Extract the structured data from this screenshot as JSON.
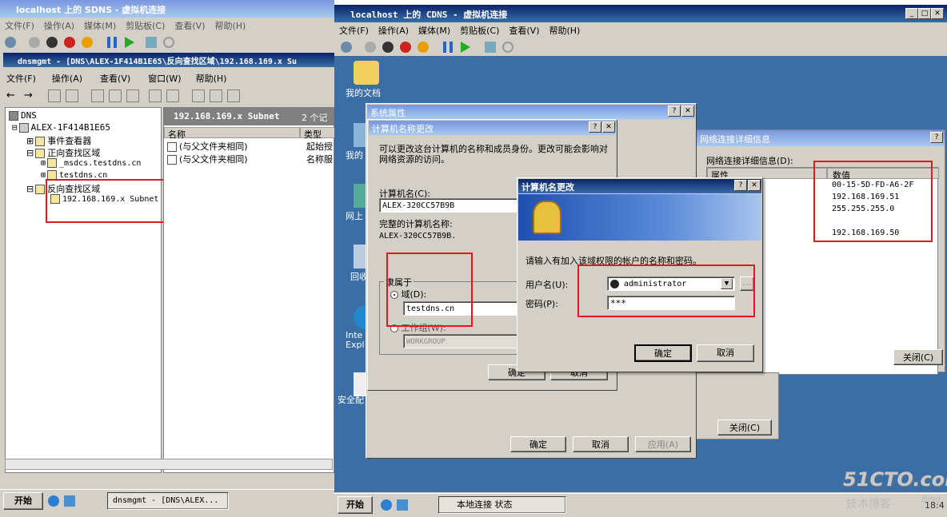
{
  "left_window": {
    "title": "localhost 上的 SDNS - 虚拟机连接",
    "menu": [
      "文件(F)",
      "操作(A)",
      "媒体(M)",
      "剪贴板(C)",
      "查看(V)",
      "帮助(H)"
    ]
  },
  "mmc": {
    "title": "dnsmgmt - [DNS\\ALEX-1F414B1E65\\反向查找区域\\192.168.169.x Su",
    "menu": [
      "文件(F)",
      "操作(A)",
      "查看(V)",
      "窗口(W)",
      "帮助(H)"
    ],
    "tree": [
      "DNS",
      "ALEX-1F414B1E65",
      "事件查看器",
      "正向查找区域",
      "_msdcs.testdns.cn",
      "testdns.cn",
      "反向查找区域",
      "192.168.169.x Subnet"
    ],
    "list_header": "192.168.169.x Subnet",
    "list_count": "2 个记",
    "columns": [
      "名称",
      "类型"
    ],
    "rows": [
      {
        "name": "(与父文件夹相同)",
        "type": "起始授"
      },
      {
        "name": "(与父文件夹相同)",
        "type": "名称服"
      }
    ]
  },
  "left_taskbar": {
    "start": "开始",
    "task": "dnsmgmt - [DNS\\ALEX..."
  },
  "right_window": {
    "title": "localhost 上的 CDNS - 虚拟机连接",
    "menu": [
      "文件(F)",
      "操作(A)",
      "媒体(M)",
      "剪贴板(C)",
      "查看(V)",
      "帮助(H)"
    ]
  },
  "desktop_icons": [
    "我的文档",
    "我的",
    "网上",
    "回收",
    "Inte\nExpl",
    "安全配"
  ],
  "sysprops": {
    "title": "系统属性",
    "buttons": [
      "确定",
      "取消",
      "应用(A)"
    ]
  },
  "namechange": {
    "title": "计算机名称更改",
    "desc": "可以更改这台计算机的名称和成员身份。更改可能会影响对网络资源的访问。",
    "name_label": "计算机名(C):",
    "name_value": "ALEX-320CC57B9B",
    "full_label": "完整的计算机名称:",
    "full_value": "ALEX-320CC57B9B.",
    "member_label": "隶属于",
    "domain_label": "域(D):",
    "domain_value": "testdns.cn",
    "workgroup_label": "工作组(W):",
    "workgroup_value": "WORKGROUP",
    "ok": "确定",
    "cancel": "取消"
  },
  "credentials": {
    "title": "计算机名更改",
    "prompt": "请输入有加入该域权限的帐户的名称和密码。",
    "user_label": "用户名(U):",
    "user_value": "administrator",
    "pwd_label": "密码(P):",
    "pwd_value": "***",
    "ok": "确定",
    "cancel": "取消"
  },
  "netdetail": {
    "title": "网络连接详细信息",
    "subtitle": "网络连接详细信息(D):",
    "columns": [
      "属性",
      "数值"
    ],
    "values": [
      "00-15-5D-FD-A6-2F",
      "192.168.169.51",
      "255.255.255.0",
      "",
      "192.168.169.50"
    ],
    "close": "关闭(C)"
  },
  "netstatus": {
    "close": "关闭(C)"
  },
  "right_taskbar": {
    "start": "开始",
    "task": "本地连接 状态",
    "clock": "18:4"
  },
  "watermark": {
    "brand": "51CTO.com",
    "sub": "技术博客",
    "blog": "Blog"
  }
}
